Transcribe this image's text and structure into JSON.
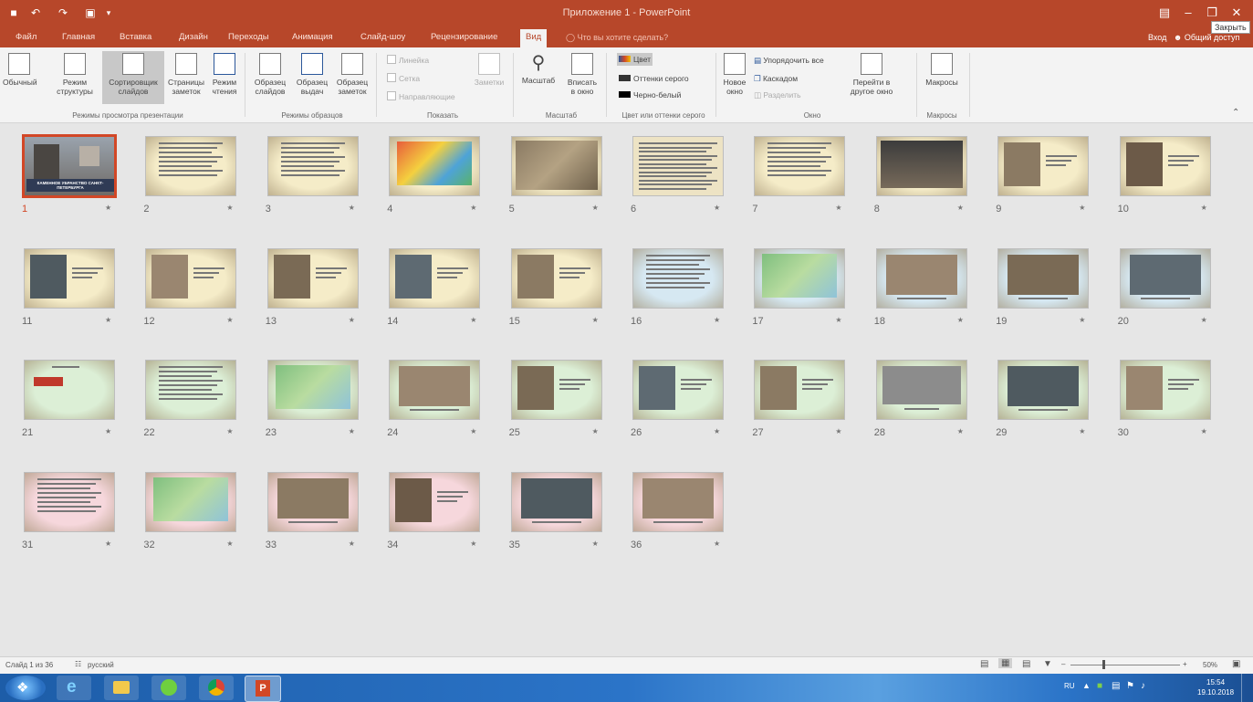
{
  "titlebar": {
    "title": "Приложение 1 - PowerPoint",
    "close_tooltip": "Закрыть"
  },
  "tabs": [
    {
      "label": "Файл"
    },
    {
      "label": "Главная"
    },
    {
      "label": "Вставка"
    },
    {
      "label": "Дизайн"
    },
    {
      "label": "Переходы"
    },
    {
      "label": "Анимация"
    },
    {
      "label": "Слайд-шоу"
    },
    {
      "label": "Рецензирование"
    },
    {
      "label": "Вид"
    }
  ],
  "tell_me": "Что вы хотите сделать?",
  "user": {
    "signin": "Вход",
    "share": "Общий доступ"
  },
  "ribbon": {
    "presentation_views": {
      "label": "Режимы просмотра презентации",
      "buttons": [
        {
          "label1": "Обычный",
          "label2": ""
        },
        {
          "label1": "Режим",
          "label2": "структуры"
        },
        {
          "label1": "Сортировщик",
          "label2": "слайдов"
        },
        {
          "label1": "Страницы",
          "label2": "заметок"
        },
        {
          "label1": "Режим",
          "label2": "чтения"
        }
      ]
    },
    "master_views": {
      "label": "Режимы образцов",
      "buttons": [
        {
          "label1": "Образец",
          "label2": "слайдов"
        },
        {
          "label1": "Образец",
          "label2": "выдач"
        },
        {
          "label1": "Образец",
          "label2": "заметок"
        }
      ]
    },
    "show": {
      "label": "Показать",
      "ruler": "Линейка",
      "gridlines": "Сетка",
      "guides": "Направляющие",
      "notes": "Заметки"
    },
    "zoom": {
      "label": "Масштаб",
      "zoom_btn": "Масштаб",
      "fit_line1": "Вписать",
      "fit_line2": "в окно"
    },
    "color": {
      "label": "Цвет или оттенки серого",
      "color": "Цвет",
      "grayscale": "Оттенки серого",
      "bw": "Черно-белый"
    },
    "window": {
      "label": "Окно",
      "new_line1": "Новое",
      "new_line2": "окно",
      "arrange": "Упорядочить все",
      "cascade": "Каскадом",
      "split": "Разделить",
      "switch_line1": "Перейти в",
      "switch_line2": "другое окно"
    },
    "macros": {
      "label": "Макросы",
      "btn": "Макросы"
    }
  },
  "slides": [
    {
      "num": "1",
      "theme": "title",
      "selected": true,
      "title": "КАМЕННОЕ УБРАНСТВО САНКТ-ПЕТЕРБУРГА"
    },
    {
      "num": "2",
      "theme": "text-cream"
    },
    {
      "num": "3",
      "theme": "text-cream"
    },
    {
      "num": "4",
      "theme": "map-color"
    },
    {
      "num": "5",
      "theme": "photo-rock"
    },
    {
      "num": "6",
      "theme": "doc"
    },
    {
      "num": "7",
      "theme": "text-cream"
    },
    {
      "num": "8",
      "theme": "photo-dark"
    },
    {
      "num": "9",
      "theme": "photo-statue-cream"
    },
    {
      "num": "10",
      "theme": "photo-side-cream"
    },
    {
      "num": "11",
      "theme": "photo-side-cream"
    },
    {
      "num": "12",
      "theme": "photo-side-cream"
    },
    {
      "num": "13",
      "theme": "photo-side-cream"
    },
    {
      "num": "14",
      "theme": "photo-side-cream"
    },
    {
      "num": "15",
      "theme": "photo-side-cream"
    },
    {
      "num": "16",
      "theme": "text-blue"
    },
    {
      "num": "17",
      "theme": "map-blue"
    },
    {
      "num": "18",
      "theme": "photo-blue"
    },
    {
      "num": "19",
      "theme": "photo-blue"
    },
    {
      "num": "20",
      "theme": "photo-blue"
    },
    {
      "num": "21",
      "theme": "list-green"
    },
    {
      "num": "22",
      "theme": "text-green"
    },
    {
      "num": "23",
      "theme": "map-green"
    },
    {
      "num": "24",
      "theme": "photo-green"
    },
    {
      "num": "25",
      "theme": "photo-side-green"
    },
    {
      "num": "26",
      "theme": "photo-side-green"
    },
    {
      "num": "27",
      "theme": "photo-side-green"
    },
    {
      "num": "28",
      "theme": "photo-gray-green"
    },
    {
      "num": "29",
      "theme": "photo-green"
    },
    {
      "num": "30",
      "theme": "photo-side-green"
    },
    {
      "num": "31",
      "theme": "text-pink"
    },
    {
      "num": "32",
      "theme": "map-pink"
    },
    {
      "num": "33",
      "theme": "photo-pink"
    },
    {
      "num": "34",
      "theme": "photo-side-pink"
    },
    {
      "num": "35",
      "theme": "photo-pink"
    },
    {
      "num": "36",
      "theme": "photo-pink"
    }
  ],
  "status": {
    "slide_of": "Слайд 1 из 36",
    "language": "русский",
    "zoom": "50%"
  },
  "taskbar": {
    "lang": "RU",
    "time": "15:54",
    "date": "19.10.2018"
  },
  "colors": {
    "accent": "#b7472a",
    "selection": "#d24726",
    "cream": "#f5ecc8",
    "blue": "#d6e8f2",
    "green": "#dcefd6",
    "pink": "#f6d7dc"
  }
}
